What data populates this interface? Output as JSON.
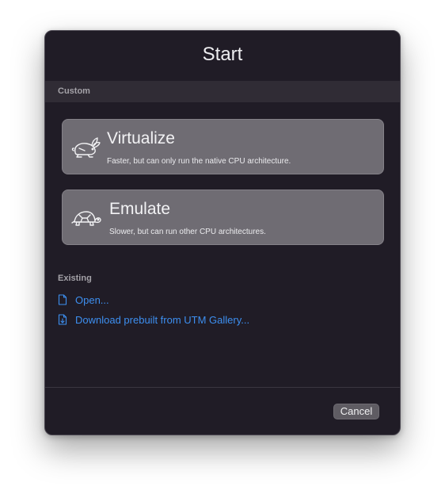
{
  "window": {
    "title": "Start"
  },
  "custom": {
    "section_label": "Custom",
    "options": [
      {
        "title": "Virtualize",
        "subtitle": "Faster, but can only run the native CPU architecture.",
        "icon": "rabbit-icon"
      },
      {
        "title": "Emulate",
        "subtitle": "Slower, but can run other CPU architectures.",
        "icon": "turtle-icon"
      }
    ]
  },
  "existing": {
    "section_label": "Existing",
    "links": [
      {
        "label": "Open...",
        "icon": "document-icon"
      },
      {
        "label": "Download prebuilt from UTM Gallery...",
        "icon": "document-download-icon"
      }
    ]
  },
  "footer": {
    "cancel_label": "Cancel"
  },
  "colors": {
    "window_bg": "#201c26",
    "card_bg": "#6f6c73",
    "link": "#3d8ff0"
  }
}
